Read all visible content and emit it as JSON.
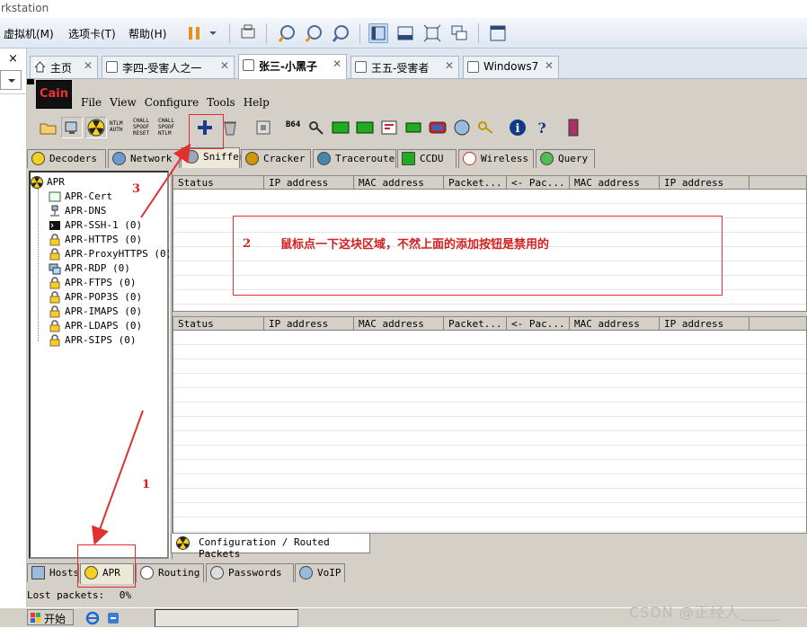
{
  "vmware": {
    "title_fragment": "rkstation",
    "menu": [
      "虚拟机(M)",
      "选项卡(T)",
      "帮助(H)"
    ],
    "tabs": [
      {
        "label": "主页",
        "active": false
      },
      {
        "label": "李四-受害人之一",
        "active": false
      },
      {
        "label": "张三-小黑子",
        "active": true
      },
      {
        "label": "王五-受害者",
        "active": false
      },
      {
        "label": "Windows7",
        "active": false
      }
    ],
    "side_close": "×"
  },
  "cain": {
    "logo": "Cain",
    "menu": [
      "File",
      "View",
      "Configure",
      "Tools",
      "Help"
    ],
    "toolbar_texts": {
      "ntlm_auth": "NTLM AUTH",
      "chall_reset": "CHALL SPOOF RESET",
      "chall_ntlm": "CHALL SPOOF NTLM",
      "b64": "B64"
    },
    "tabs": [
      {
        "label": "Decoders",
        "active": false
      },
      {
        "label": "Network",
        "active": false
      },
      {
        "label": "Sniffer",
        "active": true
      },
      {
        "label": "Cracker",
        "active": false
      },
      {
        "label": "Traceroute",
        "active": false
      },
      {
        "label": "CCDU",
        "active": false
      },
      {
        "label": "Wireless",
        "active": false
      },
      {
        "label": "Query",
        "active": false
      }
    ],
    "tree": [
      {
        "label": "APR",
        "icon": "radiation-icon"
      },
      {
        "label": "APR-Cert",
        "icon": "certificate-icon"
      },
      {
        "label": "APR-DNS",
        "icon": "network-computer-icon"
      },
      {
        "label": "APR-SSH-1  (0)",
        "icon": "terminal-icon"
      },
      {
        "label": "APR-HTTPS  (0)",
        "icon": "lock-icon"
      },
      {
        "label": "APR-ProxyHTTPS  (0)",
        "icon": "lock-icon"
      },
      {
        "label": "APR-RDP  (0)",
        "icon": "remote-desktop-icon"
      },
      {
        "label": "APR-FTPS  (0)",
        "icon": "lock-icon"
      },
      {
        "label": "APR-POP3S  (0)",
        "icon": "lock-icon"
      },
      {
        "label": "APR-IMAPS  (0)",
        "icon": "lock-icon"
      },
      {
        "label": "APR-LDAPS  (0)",
        "icon": "lock-icon"
      },
      {
        "label": "APR-SIPS  (0)",
        "icon": "lock-icon"
      }
    ],
    "columns": [
      "Status",
      "IP address",
      "MAC address",
      "Packet...",
      "<- Pac...",
      "MAC address",
      "IP address"
    ],
    "config_tab": "Configuration / Routed Packets",
    "bottom_tabs": [
      {
        "label": "Hosts",
        "active": false
      },
      {
        "label": "APR",
        "active": true
      },
      {
        "label": "Routing",
        "active": false
      },
      {
        "label": "Passwords",
        "active": false
      },
      {
        "label": "VoIP",
        "active": false
      }
    ],
    "status_label": "Lost packets:",
    "status_value": "0%"
  },
  "taskbar": {
    "start": "开始"
  },
  "watermark": "CSDN @正经人_____",
  "annotations": {
    "n1": "1",
    "n2": "2",
    "n3": "3",
    "note": "鼠标点一下这块区域，不然上面的添加按钮是禁用的",
    "color": "#e03030"
  }
}
